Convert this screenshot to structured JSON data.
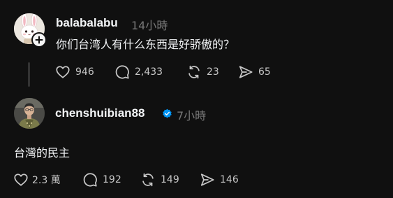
{
  "posts": [
    {
      "username": "balabalabu",
      "time": "14小時",
      "text": "你们台湾人有什么东西是好骄傲的？",
      "likes": "946",
      "comments": "2,433",
      "reposts": "23",
      "shares": "65"
    },
    {
      "username": "chenshuibian88",
      "time": "7小時",
      "text": "台灣的民主",
      "likes": "2.3 萬",
      "comments": "192",
      "reposts": "149",
      "shares": "146"
    }
  ],
  "colors": {
    "background": "#101010",
    "primary_text": "#f3f5f7",
    "secondary_text": "#777777",
    "icon": "#c7c7c7",
    "verified": "#0095f6"
  },
  "icons": [
    "heart-icon",
    "comment-icon",
    "repost-icon",
    "share-icon",
    "plus-icon",
    "verified-icon"
  ]
}
